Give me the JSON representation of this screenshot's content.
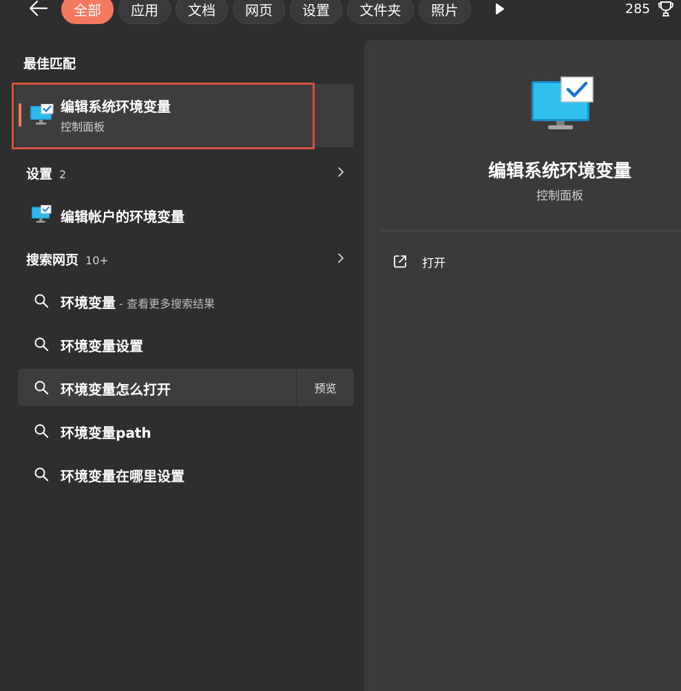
{
  "tabs": [
    {
      "label": "全部",
      "active": true
    },
    {
      "label": "应用"
    },
    {
      "label": "文档"
    },
    {
      "label": "网页"
    },
    {
      "label": "设置"
    },
    {
      "label": "文件夹"
    },
    {
      "label": "照片"
    }
  ],
  "rewards": {
    "points": "285",
    "icon": "trophy-icon"
  },
  "best_match": {
    "heading": "最佳匹配",
    "title": "编辑系统环境变量",
    "subtitle": "控制面板",
    "icon": "system-env-monitor-icon"
  },
  "settings_section": {
    "heading": "设置",
    "count": "2",
    "items": [
      {
        "label": "编辑帐户的环境变量",
        "icon": "system-env-monitor-icon"
      }
    ]
  },
  "web_section": {
    "heading": "搜索网页",
    "count": "10+",
    "items": [
      {
        "label": "环境变量",
        "hint": " - 查看更多搜索结果"
      },
      {
        "label": "环境变量设置",
        "hint": ""
      },
      {
        "label": "环境变量怎么打开",
        "hint": "",
        "preview_label": "预览"
      },
      {
        "label": "环境变量path",
        "hint": ""
      },
      {
        "label": "环境变量在哪里设置",
        "hint": ""
      }
    ]
  },
  "detail": {
    "title": "编辑系统环境变量",
    "subtitle": "控制面板",
    "actions": [
      {
        "label": "打开",
        "icon": "open-external-icon"
      }
    ]
  },
  "colors": {
    "accent": "#f47a5f",
    "highlight_outline": "#d9503b",
    "background": "#2e2e2e",
    "panel": "#3a3a3a"
  }
}
